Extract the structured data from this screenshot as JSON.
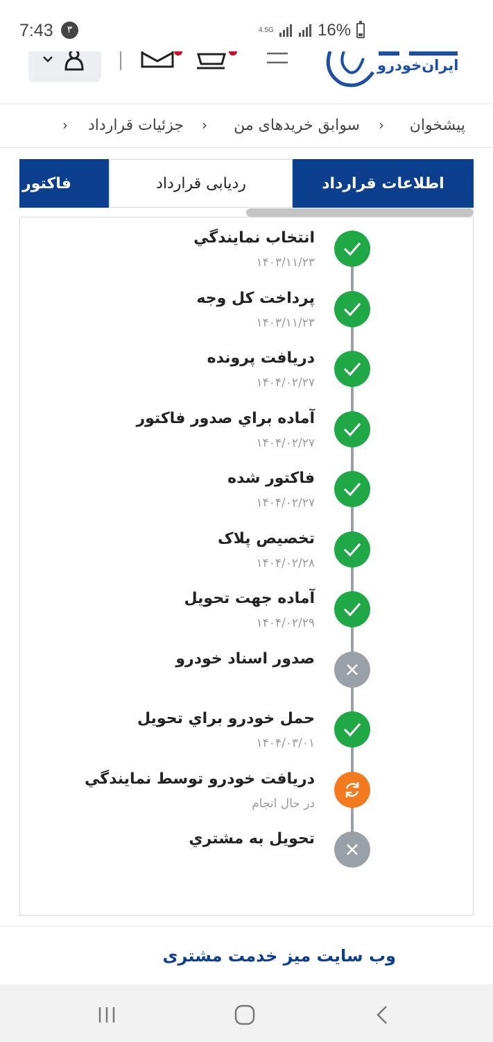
{
  "status_bar": {
    "time": "7:43",
    "notification_count": "۳",
    "network_type": "4.5G",
    "battery_percent": "16%"
  },
  "header": {
    "logo_text": "ایران‌خودرو",
    "icons": [
      "user-icon",
      "mail-icon",
      "cart-icon",
      "menu-icon"
    ]
  },
  "breadcrumb": {
    "items": [
      "پیشخوان",
      "سوابق خریدهای من",
      "جزئیات قرارداد"
    ]
  },
  "tabs": {
    "items": [
      {
        "label": "اطلاعات قرارداد",
        "active": true
      },
      {
        "label": "ردیابی قرارداد",
        "active": false
      },
      {
        "label": "فاکتور",
        "active": true
      }
    ]
  },
  "timeline": {
    "steps": [
      {
        "title": "انتخاب نمايندگي",
        "date": "۱۴۰۳/۱۱/۲۳",
        "status": "done"
      },
      {
        "title": "پرداخت کل وجه",
        "date": "۱۴۰۳/۱۱/۲۳",
        "status": "done"
      },
      {
        "title": "دريافت پرونده",
        "date": "۱۴۰۴/۰۲/۲۷",
        "status": "done"
      },
      {
        "title": "آماده براي صدور فاکتور",
        "date": "۱۴۰۴/۰۲/۲۷",
        "status": "done"
      },
      {
        "title": "فاکتور شده",
        "date": "۱۴۰۴/۰۲/۲۷",
        "status": "done"
      },
      {
        "title": "تخصيص پلاک",
        "date": "۱۴۰۴/۰۲/۲۸",
        "status": "done"
      },
      {
        "title": "آماده جهت تحويل",
        "date": "۱۴۰۴/۰۲/۲۹",
        "status": "done"
      },
      {
        "title": "صدور اسناد خودرو",
        "date": "",
        "status": "failed"
      },
      {
        "title": "حمل خودرو براي تحويل",
        "date": "۱۴۰۴/۰۳/۰۱",
        "status": "done"
      },
      {
        "title": "دريافت خودرو توسط نمايندگي",
        "date": "در حال انجام",
        "status": "in-progress"
      },
      {
        "title": "تحويل به مشتري",
        "date": "",
        "status": "failed"
      }
    ]
  },
  "footer": {
    "link_label": "وب سایت میز خدمت مشتری"
  },
  "colors": {
    "primary": "#0c3f8d",
    "done": "#21a846",
    "failed": "#9aa0a8",
    "in_progress": "#f47a20"
  }
}
